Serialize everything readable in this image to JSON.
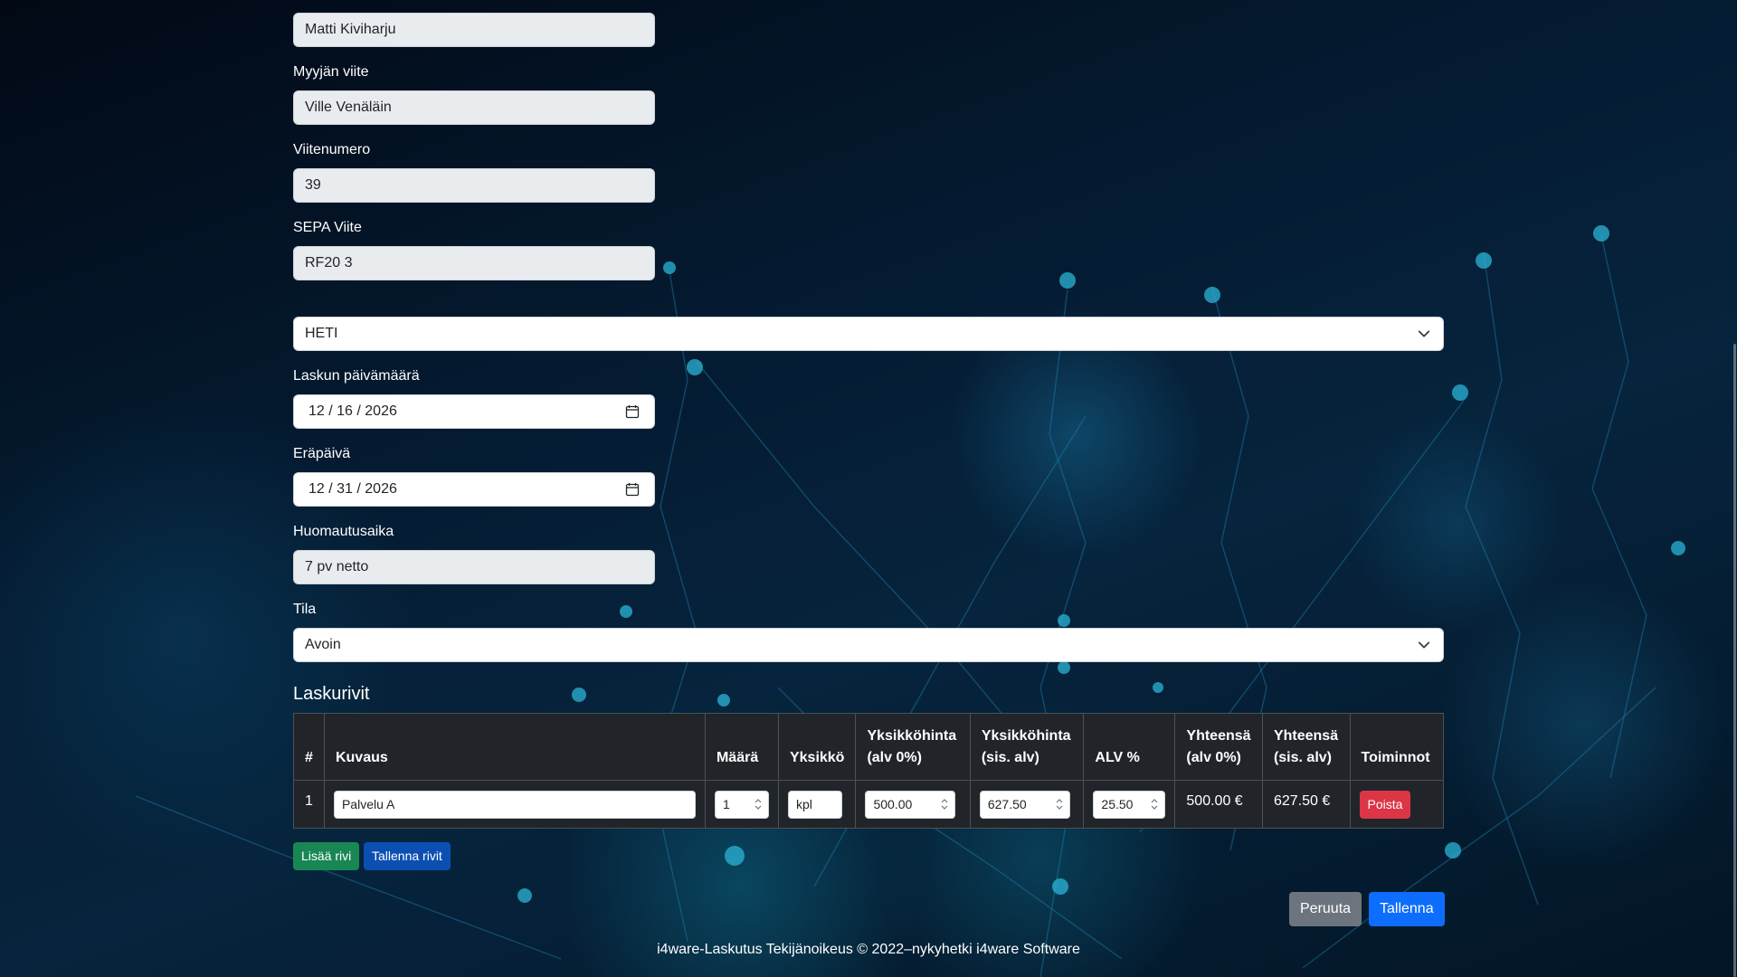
{
  "form": {
    "customer_contact": {
      "value": "Matti Kiviharju"
    },
    "seller_reference": {
      "label": "Myyjän viite",
      "value": "Ville Venäläin"
    },
    "reference_number": {
      "label": "Viitenumero",
      "value": "39"
    },
    "sepa_reference": {
      "label": "SEPA Viite",
      "value": "RF20 3"
    },
    "payment_terms": {
      "selected": "HETI"
    },
    "invoice_date": {
      "label": "Laskun päivämäärä",
      "value": "12 / 16 / 2026"
    },
    "due_date": {
      "label": "Eräpäivä",
      "value": "12 / 31 / 2026"
    },
    "notice_period": {
      "label": "Huomautusaika",
      "value": "7 pv netto"
    },
    "status": {
      "label": "Tila",
      "selected": "Avoin"
    }
  },
  "invoice_lines": {
    "title": "Laskurivit",
    "columns": {
      "index": "#",
      "description": "Kuvaus",
      "quantity": "Määrä",
      "unit": "Yksikkö",
      "unit_price_net_1": "Yksikköhinta",
      "unit_price_net_2": "(alv 0%)",
      "unit_price_gross_1": "Yksikköhinta",
      "unit_price_gross_2": "(sis. alv)",
      "vat": "ALV %",
      "total_net_1": "Yhteensä",
      "total_net_2": "(alv 0%)",
      "total_gross_1": "Yhteensä",
      "total_gross_2": "(sis. alv)",
      "actions": "Toiminnot"
    },
    "rows": [
      {
        "index": "1",
        "description": "Palvelu A",
        "quantity": "1",
        "unit": "kpl",
        "unit_price_net": "500.00",
        "unit_price_gross": "627.50",
        "vat": "25.50",
        "total_net": "500.00 €",
        "total_gross": "627.50 €",
        "delete_label": "Poista"
      }
    ],
    "add_row_label": "Lisää rivi",
    "save_rows_label": "Tallenna rivit"
  },
  "actions": {
    "cancel_label": "Peruuta",
    "save_label": "Tallenna"
  },
  "footer": {
    "text": "i4ware-Laskutus Tekijänoikeus © 2022–nykyhetki i4ware Software"
  },
  "colors": {
    "success": "#198754",
    "primary": "#0d6efd",
    "secondary": "#6c757d",
    "danger": "#dc3545",
    "table_bg": "#212529",
    "readonly_bg": "#e9ecef"
  }
}
